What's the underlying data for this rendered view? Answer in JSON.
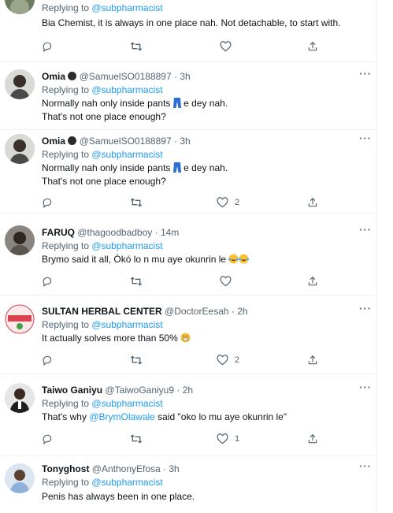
{
  "replying_prefix": "Replying to ",
  "tweets": [
    {
      "name": "",
      "handle": "",
      "time": "",
      "reply_to": "@subpharmacist",
      "lines": [
        "Bia Chemist, it is always in one place nah. Not detachable, to start with."
      ],
      "likes": ""
    },
    {
      "name": "Omia",
      "handle": "@SamuelSO0188897",
      "time": "· 3h",
      "reply_to": "@subpharmacist",
      "lines": [
        "Normally nah only inside pants",
        "e dey nah.",
        "That's not one place enough?"
      ],
      "likes": ""
    },
    {
      "name": "Omia",
      "handle": "@SamuelSO0188897",
      "time": "· 3h",
      "reply_to": "@subpharmacist",
      "lines": [
        "Normally nah only inside pants",
        "e dey nah.",
        "That's not one place enough?"
      ],
      "likes": "2"
    },
    {
      "name": "FARUQ",
      "handle": "@thagoodbadboy",
      "time": "· 14m",
      "reply_to": "@subpharmacist",
      "lines": [
        "Brymo said it all, Òkó lo n mu aye okunrin le"
      ],
      "likes": ""
    },
    {
      "name": "SULTAN HERBAL CENTER",
      "handle": "@DoctorEesah",
      "time": "· 2h",
      "reply_to": "@subpharmacist",
      "lines": [
        "It actually solves more than 50%"
      ],
      "likes": "2"
    },
    {
      "name": "Taiwo Ganiyu",
      "handle": "@TaiwoGaniyu9",
      "time": "· 2h",
      "reply_to": "@subpharmacist",
      "lines": [
        "That's why ",
        "@BrymOlawale",
        " said \"oko lo mu aye okunrin le\""
      ],
      "likes": "1"
    },
    {
      "name": "Tonyghost",
      "handle": "@AnthonyEfosa",
      "time": "· 3h",
      "reply_to": "@subpharmacist",
      "lines": [
        "Penis has always been in one place."
      ],
      "likes": ""
    }
  ],
  "icons": [
    "reply-icon",
    "retweet-icon",
    "like-icon",
    "share-icon",
    "more-icon"
  ],
  "colors": {
    "link": "#1d9bf0",
    "muted": "#536471",
    "text": "#0f1419",
    "divider": "#eff3f4"
  }
}
